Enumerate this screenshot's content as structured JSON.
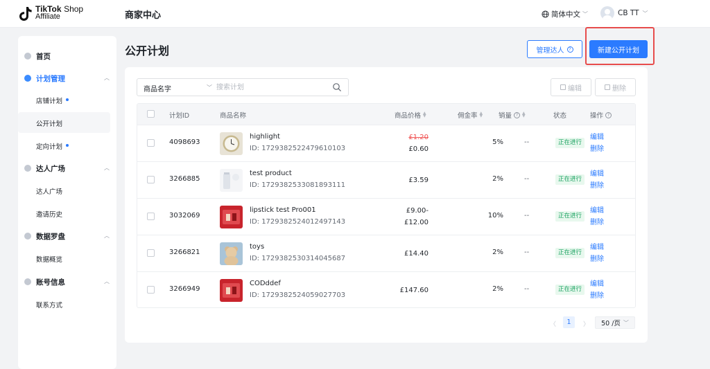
{
  "header": {
    "logo_brand": "TikTok",
    "logo_shop": "Shop",
    "logo_sub": "Affiliate",
    "title": "商家中心",
    "language": "简体中文",
    "user_name": "CB TT"
  },
  "sidebar": {
    "home": "首页",
    "plan_mgmt": "计划管理",
    "shop_plan": "店铺计划",
    "public_plan": "公开计划",
    "targeted_plan": "定向计划",
    "creator_market": "达人广场",
    "creator_market_sub": "达人广场",
    "invite_history": "邀请历史",
    "data_compass": "数据罗盘",
    "data_overview": "数据概览",
    "account_info": "账号信息",
    "contact": "联系方式"
  },
  "page": {
    "title": "公开计划",
    "manage_creators": "管理达人",
    "new_plan": "新建公开计划"
  },
  "toolbar": {
    "search_field": "商品名字",
    "search_placeholder": "搜索计划",
    "edit": "编辑",
    "delete": "删除"
  },
  "table": {
    "headers": {
      "plan_id": "计划ID",
      "product_name": "商品名称",
      "price": "商品价格",
      "commission": "佣金率",
      "sales": "销量",
      "status": "状态",
      "actions": "操作"
    },
    "rows": [
      {
        "id": "4098693",
        "name": "highlight",
        "pid": "ID: 1729382522479610103",
        "price_old": "£1.20",
        "price": "£0.60",
        "commission": "5%",
        "sales": "--",
        "status": "正在进行",
        "edit": "编辑",
        "delete": "删除"
      },
      {
        "id": "3266885",
        "name": "test product",
        "pid": "ID: 1729382533081893111",
        "price_old": "",
        "price": "£3.59",
        "commission": "2%",
        "sales": "--",
        "status": "正在进行",
        "edit": "编辑",
        "delete": "删除"
      },
      {
        "id": "3032069",
        "name": "lipstick test Pro001",
        "pid": "ID: 1729382524012497143",
        "price_old": "£9.00-",
        "price": "£12.00",
        "commission": "10%",
        "sales": "--",
        "status": "正在进行",
        "edit": "编辑",
        "delete": "删除"
      },
      {
        "id": "3266821",
        "name": "toys",
        "pid": "ID: 1729382530314045687",
        "price_old": "",
        "price": "£14.40",
        "commission": "2%",
        "sales": "--",
        "status": "正在进行",
        "edit": "编辑",
        "delete": "删除"
      },
      {
        "id": "3266949",
        "name": "CODddef",
        "pid": "ID: 1729382524059027703",
        "price_old": "",
        "price": "£147.60",
        "commission": "2%",
        "sales": "--",
        "status": "正在进行",
        "edit": "编辑",
        "delete": "删除"
      }
    ]
  },
  "pagination": {
    "current": "1",
    "page_size": "50 /页"
  },
  "colors": {
    "primary": "#2b7bff",
    "status_green": "#1aa260",
    "strike_red": "#f05151",
    "highlight_frame": "#e74c4c"
  }
}
